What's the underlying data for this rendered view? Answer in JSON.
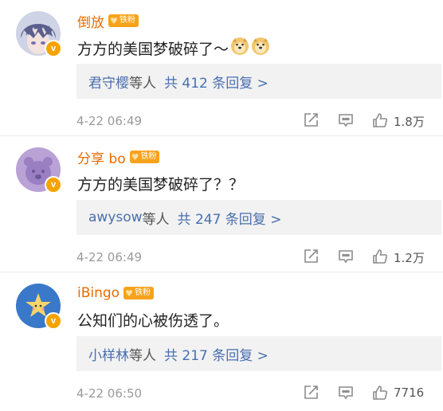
{
  "comments": [
    {
      "username": "倒放",
      "fan_badge": "铁粉",
      "text": "方方的美国梦破碎了～",
      "emojis": [
        "doge-emoji",
        "doge-emoji"
      ],
      "reply_names": "君守樱",
      "reply_etc": "等人",
      "reply_count": "共 412 条回复 >",
      "timestamp": "4-22 06:49",
      "likes": "1.8万",
      "avatar": "anime-boy-avatar"
    },
    {
      "username": "分享 bo",
      "fan_badge": "铁粉",
      "text": "方方的美国梦破碎了？？",
      "emojis": [],
      "reply_names": "awysow",
      "reply_etc": "等人",
      "reply_count": "共 247 条回复 >",
      "timestamp": "4-22 06:49",
      "likes": "1.2万",
      "avatar": "purple-bear-avatar"
    },
    {
      "username": "iBingo",
      "fan_badge": "铁粉",
      "text": "公知们的心被伤透了。",
      "emojis": [],
      "reply_names": "小样林",
      "reply_etc": "等人",
      "reply_count": "共 217 条回复 >",
      "timestamp": "4-22 06:50",
      "likes": "7716",
      "avatar": "star-avatar"
    }
  ],
  "colors": {
    "username": "#e86b00",
    "link": "#4a6fae",
    "badge": "#f7a21b",
    "verified": "#f5a300"
  },
  "icons": [
    "share-icon",
    "comment-icon",
    "like-icon"
  ]
}
